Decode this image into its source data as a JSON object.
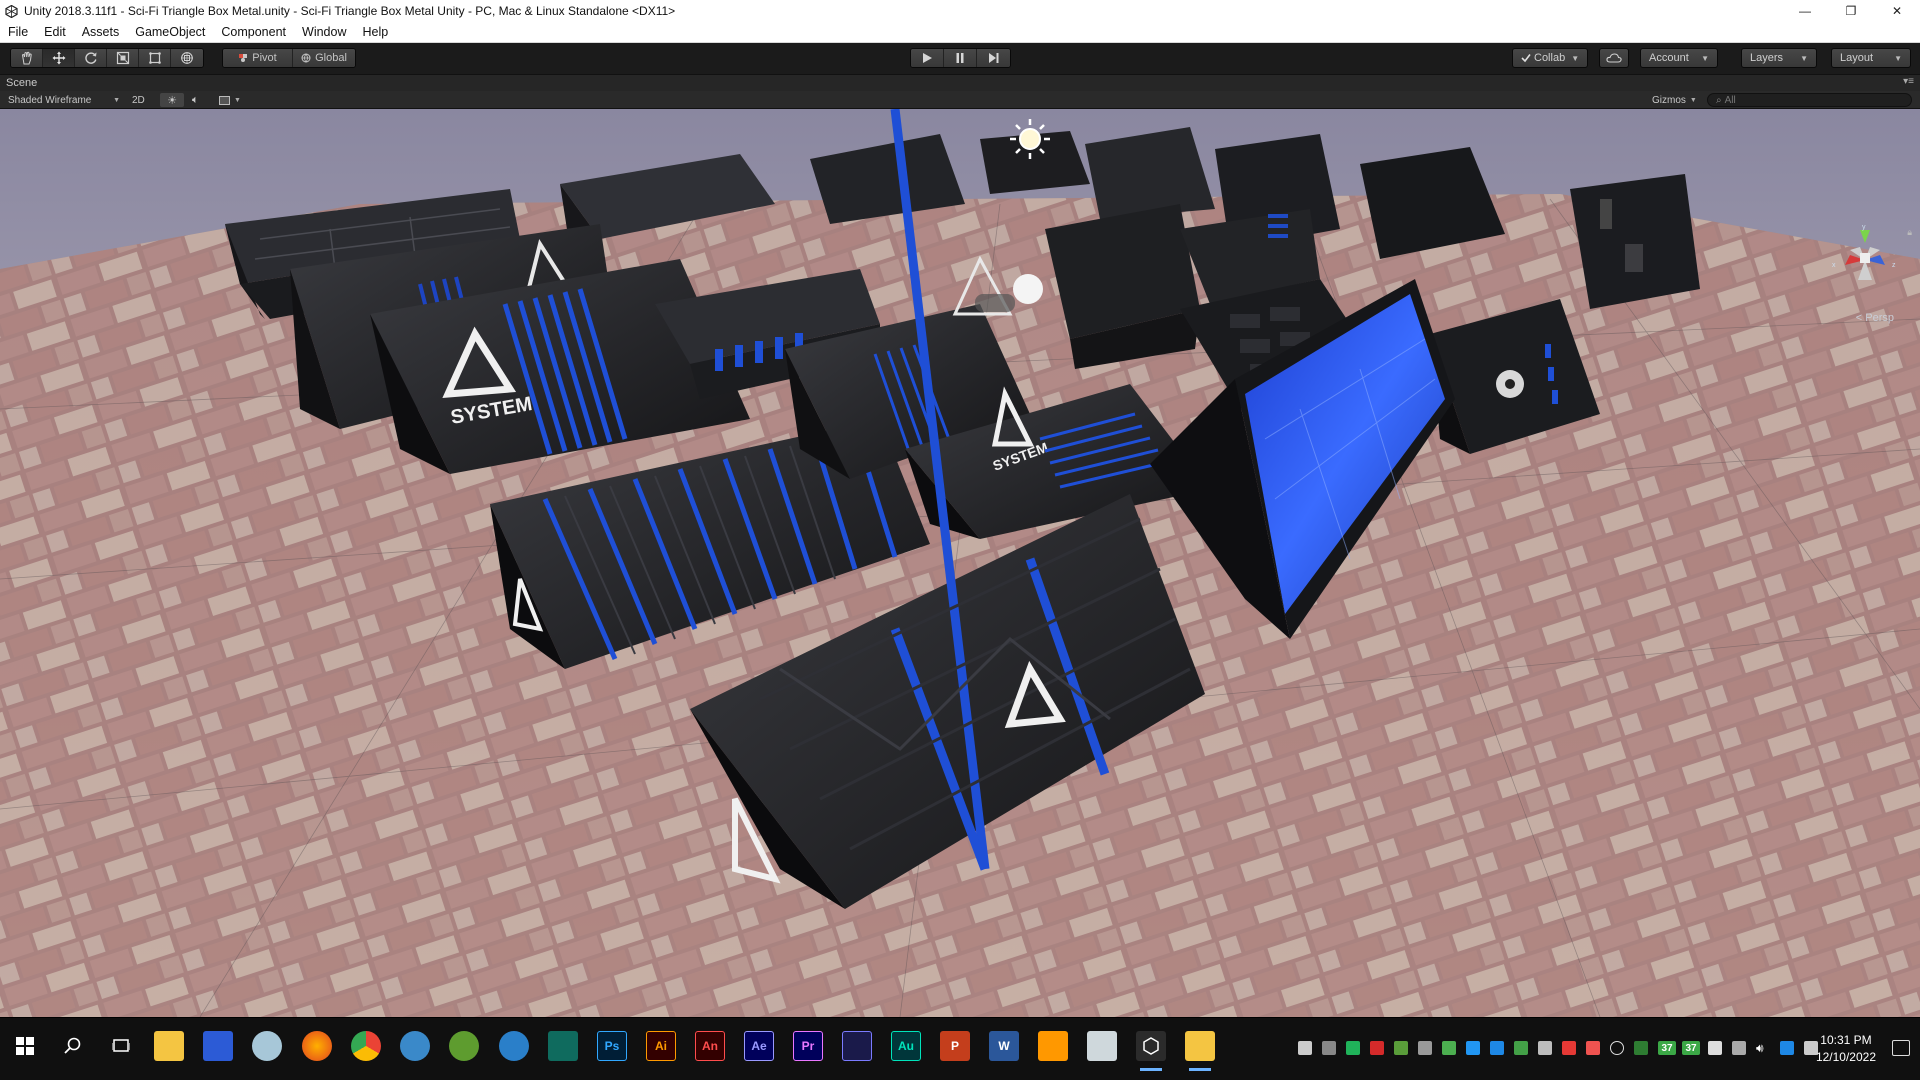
{
  "titlebar": {
    "title": "Unity 2018.3.11f1 - Sci-Fi Triangle Box Metal.unity - Sci-Fi Triangle Box Metal Unity - PC, Mac & Linux Standalone <DX11>",
    "minimize": "—",
    "maximize": "❐",
    "close": "✕"
  },
  "menu": [
    "File",
    "Edit",
    "Assets",
    "GameObject",
    "Component",
    "Window",
    "Help"
  ],
  "toolbar": {
    "pivot_label": "Pivot",
    "global_label": "Global",
    "collab_label": "Collab",
    "account_label": "Account",
    "layers_label": "Layers",
    "layout_label": "Layout"
  },
  "scene_tab": {
    "label": "Scene"
  },
  "scene_toolbar": {
    "draw_mode": "Shaded Wireframe",
    "mode_2d": "2D",
    "gizmos_label": "Gizmos",
    "search_placeholder": "All"
  },
  "viewport": {
    "persp_label": "< Persp",
    "box_labels": [
      "SYSTEM",
      "SYSTEM",
      "SYSTEM"
    ],
    "colors": {
      "sky_top": "#8c89a2",
      "sky_bottom": "#c7c2ca",
      "ground": "#a98a86",
      "box_dark": "#141416",
      "box_mid": "#2a2b30",
      "accent_blue": "#1f4fd6",
      "glass_blue": "#2a5cff"
    }
  },
  "taskbar": {
    "apps": [
      {
        "name": "windows-start",
        "glyph": "⊞"
      },
      {
        "name": "search",
        "glyph": "⌕"
      },
      {
        "name": "task-view",
        "glyph": "❐"
      },
      {
        "name": "file-explorer",
        "glyph": ""
      },
      {
        "name": "app-a",
        "glyph": ""
      },
      {
        "name": "app-b",
        "glyph": ""
      },
      {
        "name": "firefox",
        "glyph": ""
      },
      {
        "name": "chrome",
        "glyph": ""
      },
      {
        "name": "app-c",
        "glyph": ""
      },
      {
        "name": "app-d",
        "glyph": ""
      },
      {
        "name": "app-e",
        "glyph": ""
      },
      {
        "name": "app-f",
        "glyph": ""
      },
      {
        "name": "photoshop",
        "glyph": "Ps"
      },
      {
        "name": "illustrator",
        "glyph": "Ai"
      },
      {
        "name": "animate",
        "glyph": "An"
      },
      {
        "name": "after-effects",
        "glyph": "Ae"
      },
      {
        "name": "premiere",
        "glyph": "Pr"
      },
      {
        "name": "app-g",
        "glyph": ""
      },
      {
        "name": "audition",
        "glyph": "Au"
      },
      {
        "name": "powerpoint",
        "glyph": "P"
      },
      {
        "name": "word",
        "glyph": "W"
      },
      {
        "name": "sublime",
        "glyph": ""
      },
      {
        "name": "app-h",
        "glyph": ""
      },
      {
        "name": "unity",
        "glyph": ""
      },
      {
        "name": "folder",
        "glyph": ""
      }
    ],
    "tray_numbers": [
      "37",
      "37"
    ],
    "time": "10:31 PM",
    "date": "12/10/2022"
  }
}
